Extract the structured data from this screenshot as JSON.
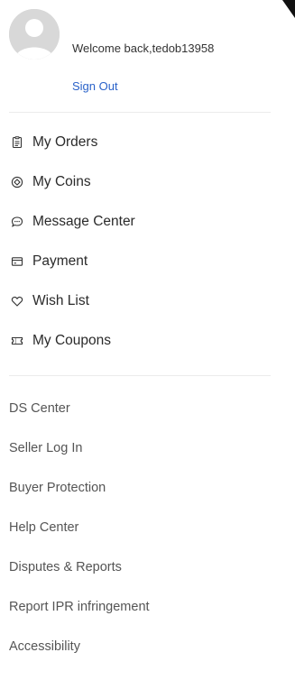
{
  "account": {
    "welcome_text": "Welcome back,tedob13958",
    "signout_label": "Sign Out",
    "avatar_icon": "user-avatar-placeholder"
  },
  "primary_menu": [
    {
      "label": "My Orders",
      "icon": "orders-icon"
    },
    {
      "label": "My Coins",
      "icon": "coins-icon"
    },
    {
      "label": "Message Center",
      "icon": "message-icon"
    },
    {
      "label": "Payment",
      "icon": "payment-card-icon"
    },
    {
      "label": "Wish List",
      "icon": "heart-icon"
    },
    {
      "label": "My Coupons",
      "icon": "coupon-icon"
    }
  ],
  "secondary_menu": [
    {
      "label": "DS Center"
    },
    {
      "label": "Seller Log In"
    },
    {
      "label": "Buyer Protection"
    },
    {
      "label": "Help Center"
    },
    {
      "label": "Disputes & Reports"
    },
    {
      "label": "Report IPR infringement"
    },
    {
      "label": "Accessibility"
    }
  ],
  "colors": {
    "link_blue": "#2a62c9",
    "divider": "#ebebeb",
    "primary_text": "#2a2a2a",
    "secondary_text": "#555555"
  }
}
